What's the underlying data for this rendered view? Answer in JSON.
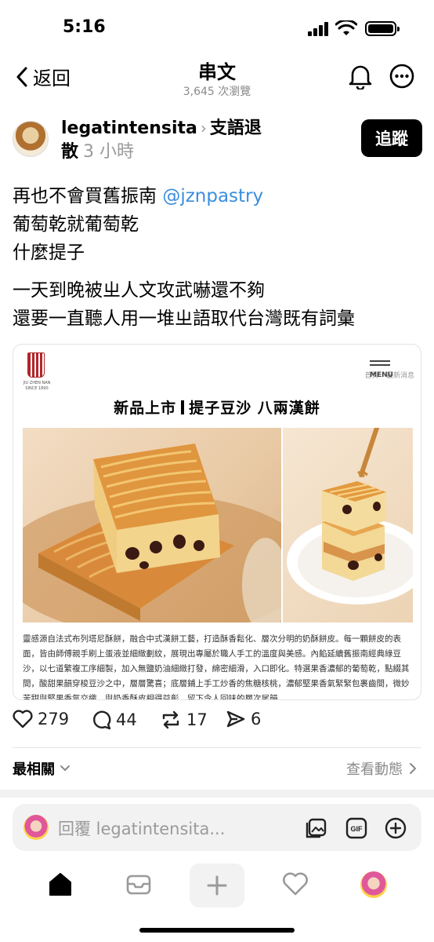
{
  "status": {
    "time": "5:16"
  },
  "nav": {
    "back_label": "返回",
    "title": "串文",
    "views": "3,645 次瀏覽"
  },
  "post": {
    "author": "legatintensita",
    "topic_part1": "支語退",
    "topic_part2": "散",
    "time": "3 小時",
    "follow_label": "追蹤",
    "lines": [
      {
        "text": "再也不會買舊振南 ",
        "mention": "@jznpastry"
      },
      {
        "text": "葡萄乾就葡萄乾"
      },
      {
        "text": "什麼提子"
      }
    ],
    "lines2": [
      "一天到晚被ㄓ人文攻武嚇還不夠",
      "還要一直聽人用一堆ㄓ語取代台灣既有詞彙"
    ]
  },
  "embed": {
    "brand_line1": "JIU ZHEN NAN",
    "brand_line2": "SINCE 1890",
    "site_nav": "首頁 › 最新消息",
    "menu_label": "MENU",
    "headline_left": "新品上市",
    "headline_right": "提子豆沙 八兩漢餅",
    "description": "靈感源自法式布列塔尼酥餅，融合中式漢餅工藝，打造酥香鬆化、層次分明的奶酥餅皮。每一顆餅皮的表面，皆由師傅親手刷上蛋液並細緻劃紋，展現出專屬於職人手工的溫度與美感。內餡延續舊振南經典綠豆沙，以七道繁複工序細製，加入無鹽奶油細緻打發，綿密細滑，入口即化。特選果香濃郁的葡萄乾，點綴其間，酸甜果韻穿梭豆沙之中，層層驚喜；底層鋪上手工炒香的焦糖核桃，濃郁堅果香氣緊緊包裹齒間，微妙苦甜與堅果香氣交織，與奶香酥皮相得益彰，留下令人回味的層次尾韻。"
  },
  "actions": {
    "likes": "279",
    "comments": "44",
    "reposts": "17",
    "shares": "6"
  },
  "sort": {
    "label": "最相關",
    "activity_label": "查看動態"
  },
  "reply": {
    "placeholder": "回覆 legatintensita..."
  },
  "colors": {
    "mention": "#3a8dde",
    "follow_bg": "#000000",
    "muted": "#8a8a8a"
  },
  "icons": [
    "chevron-left-icon",
    "bell-icon",
    "more-icon",
    "heart-icon",
    "comment-icon",
    "repost-icon",
    "share-icon",
    "image-icon",
    "gif-icon",
    "plus-icon",
    "home-icon",
    "inbox-icon",
    "heart-tab-icon"
  ]
}
